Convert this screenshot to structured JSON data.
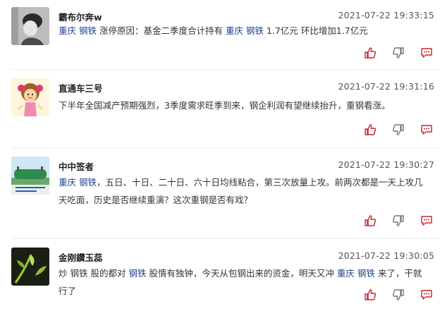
{
  "posts": [
    {
      "username": "霸布尔奔w",
      "time": "2021-07-22 19:33:15",
      "segments": [
        {
          "text": "重庆 钢铁"
        },
        {
          "text": " 涨停原因：基金二季度合计持有 "
        },
        {
          "text": "重庆 钢铁"
        },
        {
          "text": " 1.7亿元 环比增加1.7亿元"
        }
      ]
    },
    {
      "username": "直通车三号",
      "time": "2021-07-22 19:31:16",
      "segments": [
        {
          "text": "下半年全国减产预期强烈，3季度需求旺季到来，钢企利润有望继续抬升，重钢看涨。"
        }
      ]
    },
    {
      "username": "中中签者",
      "time": "2021-07-22 19:30:27",
      "segments": [
        {
          "text": "重庆 钢铁"
        },
        {
          "text": "，五日、十日、二十日、六十日均线粘合，第三次放量上攻。前两次都是一天上攻几天吃面，历史是否继续重演？这次重钢是否有戏？"
        }
      ]
    },
    {
      "username": "金刚鑽玉蕊",
      "time": "2021-07-22 19:30:05",
      "segments": [
        {
          "text": "炒 钢铁 股的都对 "
        },
        {
          "text": "钢铁"
        },
        {
          "text": " 股情有独钟，今天从包钢出来的资金，明天又冲 "
        },
        {
          "text": "重庆 钢铁"
        },
        {
          "text": " 来了，干就行了"
        }
      ]
    }
  ],
  "icons": {
    "like": "thumbs-up-icon",
    "dislike": "thumbs-down-icon",
    "comment": "comment-icon",
    "accent": "#c8232c"
  }
}
